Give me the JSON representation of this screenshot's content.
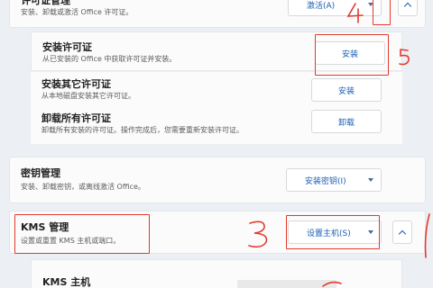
{
  "activation": {
    "title": "许可证管理",
    "description": "安装、卸载或激活 Office 许可证。",
    "dropdown_label": "激活(A)"
  },
  "install_license": {
    "title": "安装许可证",
    "description": "从已安装的 Office 中获取许可证并安装。",
    "button_label": "安装"
  },
  "install_other": {
    "title": "安装其它许可证",
    "description": "从本地磁盘安装其它许可证。",
    "button_label": "安装"
  },
  "uninstall_all": {
    "title": "卸载所有许可证",
    "description": "卸载所有安装的许可证。操作完成后，您需要重新安装许可证。",
    "button_label": "卸载"
  },
  "key_management": {
    "title": "密钥管理",
    "description": "安装、卸载密钥，或离线激活 Office。",
    "dropdown_label": "安装密钥(I)"
  },
  "kms_management": {
    "title": "KMS 管理",
    "description": "设置或重置 KMS 主机或端口。",
    "dropdown_label": "设置主机(S)"
  },
  "kms_host": {
    "title": "KMS 主机"
  },
  "annotations": {
    "colors": {
      "red": "#e23b2e"
    }
  }
}
